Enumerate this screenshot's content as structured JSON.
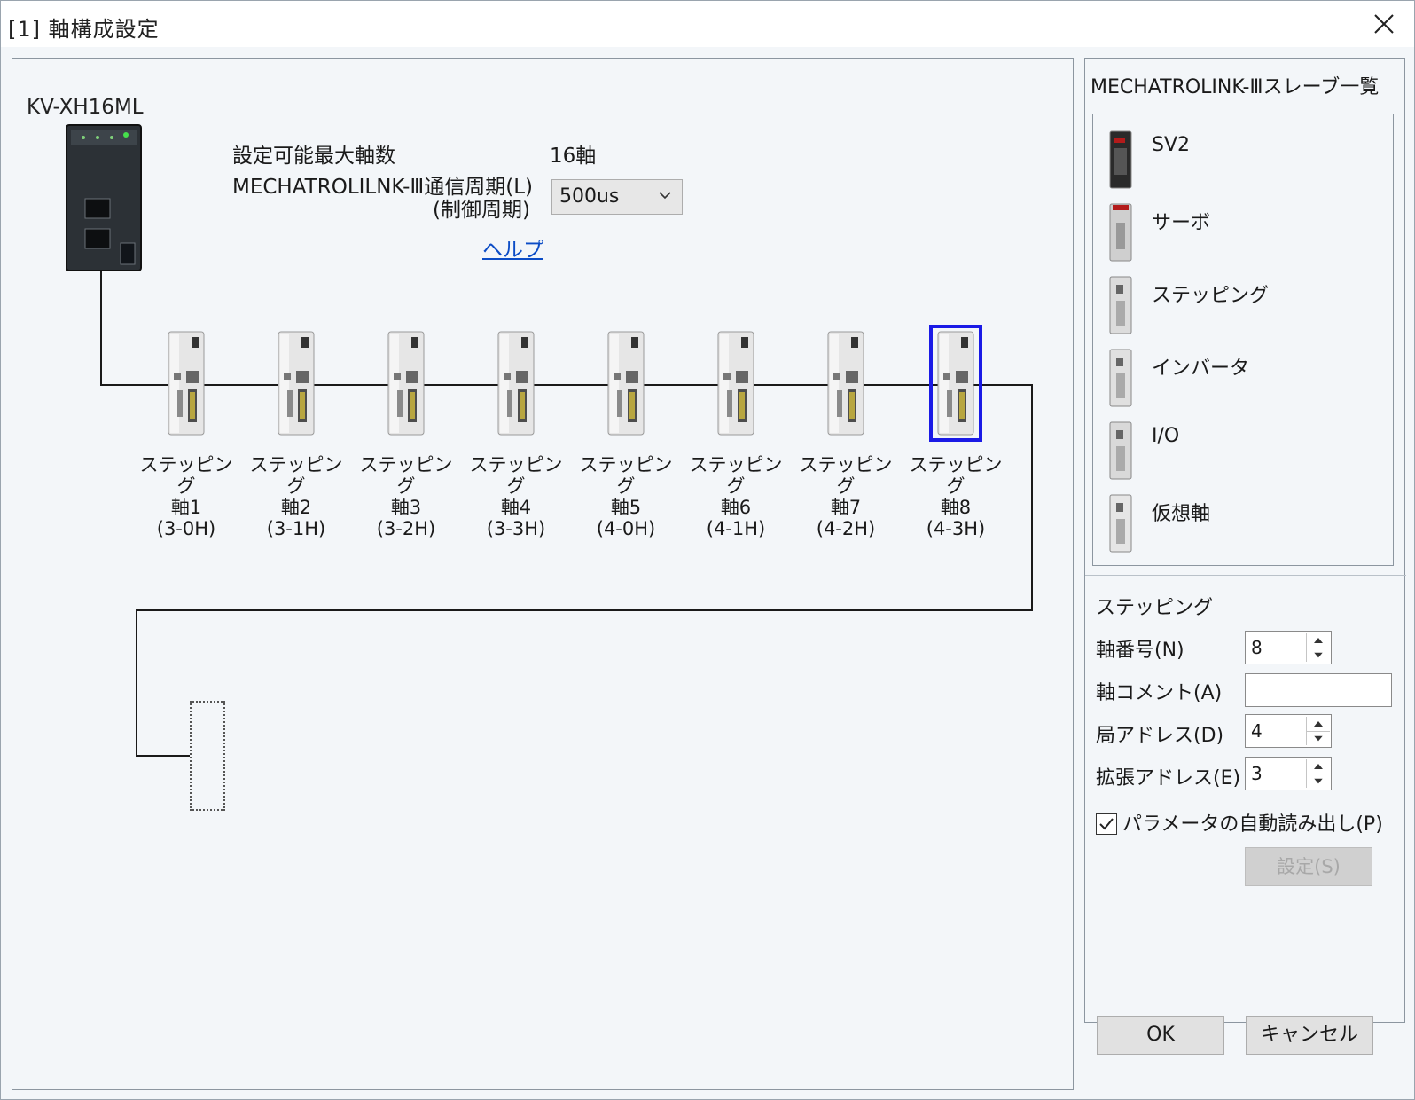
{
  "window": {
    "title": "[1] 軸構成設定"
  },
  "controller": {
    "model": "KV-XH16ML"
  },
  "settings": {
    "max_axes_label": "設定可能最大軸数",
    "max_axes_value": "16軸",
    "cycle_label_line1": "MECHATROLILNK-Ⅲ通信周期(L)",
    "cycle_label_line2": "(制御周期)",
    "cycle_value": "500us",
    "help_link": "ヘルプ"
  },
  "axes": [
    {
      "type": "ステッピング",
      "axis": "軸1",
      "address": "(3-0H)",
      "selected": false
    },
    {
      "type": "ステッピング",
      "axis": "軸2",
      "address": "(3-1H)",
      "selected": false
    },
    {
      "type": "ステッピング",
      "axis": "軸3",
      "address": "(3-2H)",
      "selected": false
    },
    {
      "type": "ステッピング",
      "axis": "軸4",
      "address": "(3-3H)",
      "selected": false
    },
    {
      "type": "ステッピング",
      "axis": "軸5",
      "address": "(4-0H)",
      "selected": false
    },
    {
      "type": "ステッピング",
      "axis": "軸6",
      "address": "(4-1H)",
      "selected": false
    },
    {
      "type": "ステッピング",
      "axis": "軸7",
      "address": "(4-2H)",
      "selected": false
    },
    {
      "type": "ステッピング",
      "axis": "軸8",
      "address": "(4-3H)",
      "selected": true
    }
  ],
  "slave_panel": {
    "title": "MECHATROLINK-Ⅲスレーブ一覧",
    "items": [
      {
        "name": "SV2",
        "icon": "sv2-drive-icon"
      },
      {
        "name": "サーボ",
        "icon": "servo-drive-icon"
      },
      {
        "name": "ステッピング",
        "icon": "stepping-drive-icon"
      },
      {
        "name": "インバータ",
        "icon": "inverter-icon"
      },
      {
        "name": "I/O",
        "icon": "io-module-icon"
      },
      {
        "name": "仮想軸",
        "icon": "virtual-axis-icon"
      }
    ]
  },
  "properties": {
    "title": "ステッピング",
    "axis_number_label": "軸番号(N)",
    "axis_number_value": "8",
    "axis_comment_label": "軸コメント(A)",
    "axis_comment_value": "",
    "station_address_label": "局アドレス(D)",
    "station_address_value": "4",
    "ext_address_label": "拡張アドレス(E)",
    "ext_address_value": "3",
    "auto_read_label": "パラメータの自動読み出し(P)",
    "auto_read_checked": true,
    "set_button": "設定(S)"
  },
  "footer": {
    "ok": "OK",
    "cancel": "キャンセル"
  },
  "colors": {
    "selection": "#1a1ae6",
    "link": "#0b4cc6",
    "bus_line": "#1a1a1a"
  }
}
